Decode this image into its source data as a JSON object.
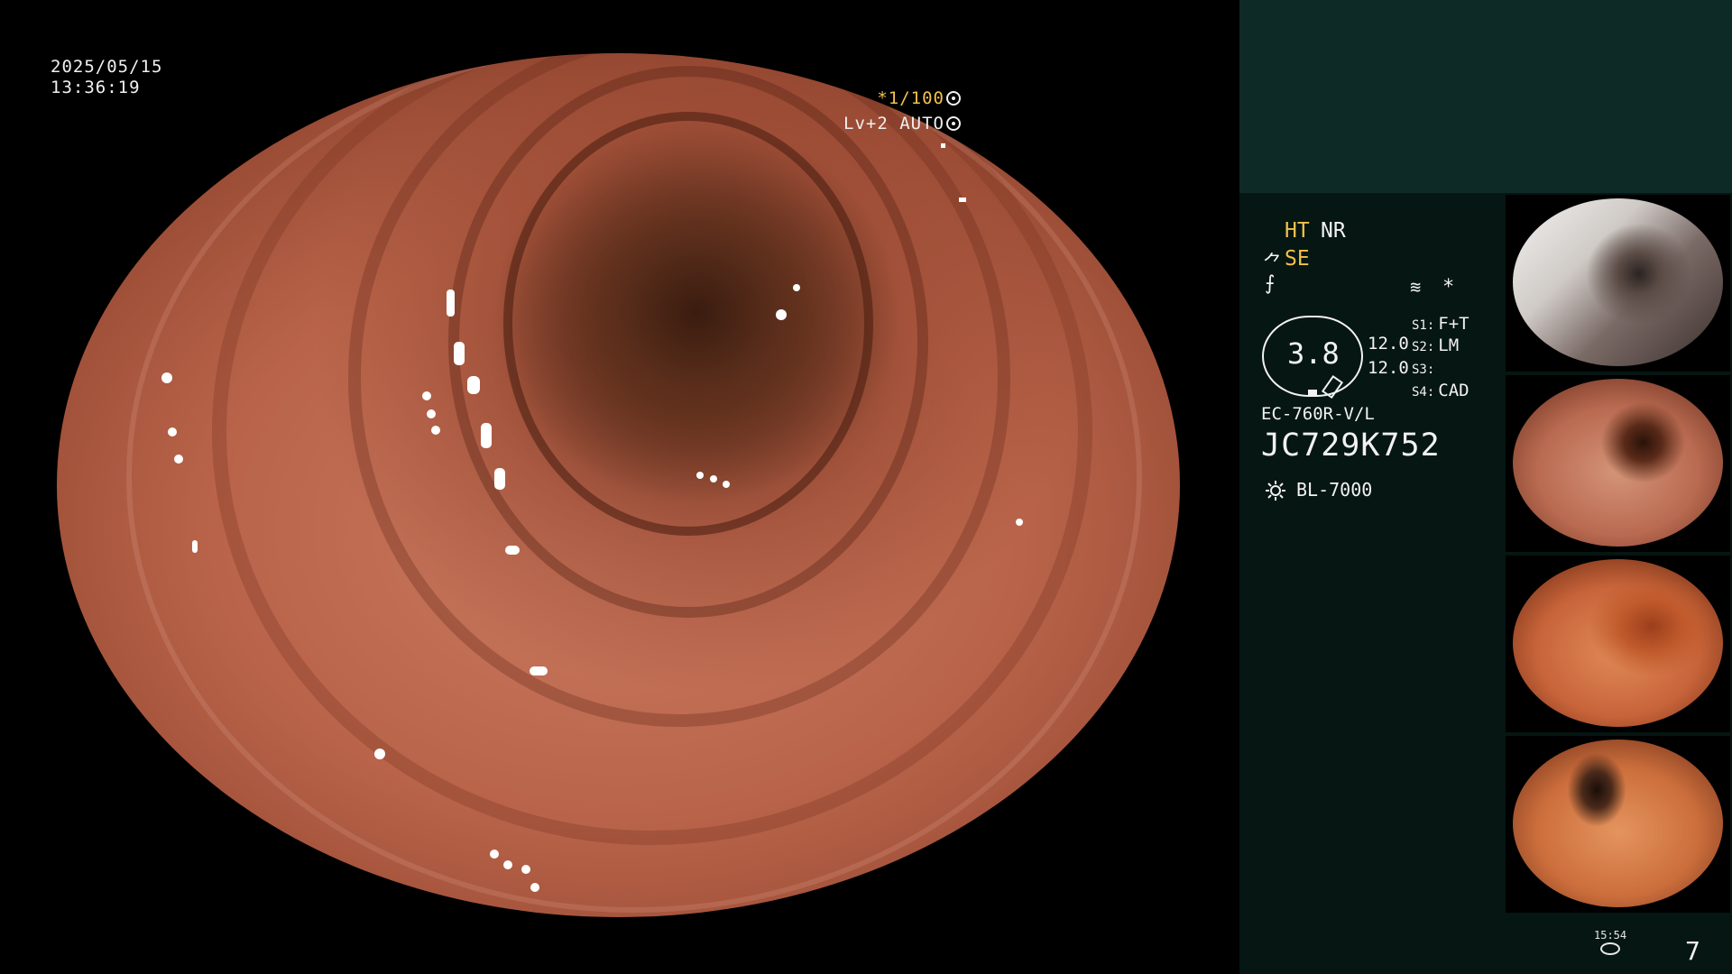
{
  "overlay": {
    "date": "2025/05/15",
    "time": "13:36:19",
    "magnification": "*1/100",
    "level": "Lv+2 AUTO"
  },
  "panel": {
    "modes": {
      "ht": "HT",
      "nr": "NR",
      "se": "SE",
      "se_icon": "⺈",
      "f_icon": "⨍",
      "asterisk": "*",
      "screen_icon": "≋"
    },
    "zoom_value": "3.8",
    "values": [
      "12.0",
      "12.0"
    ],
    "switches": [
      {
        "key": "S1:",
        "value": "F+T"
      },
      {
        "key": "S2:",
        "value": "LM"
      },
      {
        "key": "S3:",
        "value": ""
      },
      {
        "key": "S4:",
        "value": "CAD"
      }
    ],
    "scope_model": "EC-760R-V/L",
    "scope_serial": "JC729K752",
    "light_source": "BL-7000",
    "storage_time": "15:54",
    "image_count": "7"
  },
  "colors": {
    "accent": "#f2c14e",
    "panel_top": "#0e2a26",
    "panel": "#061612"
  },
  "icons": {
    "magnify_glyph": "shutter-icon",
    "level_glyph": "shutter-icon",
    "light": "light-source-icon",
    "storage": "storage-icon"
  }
}
